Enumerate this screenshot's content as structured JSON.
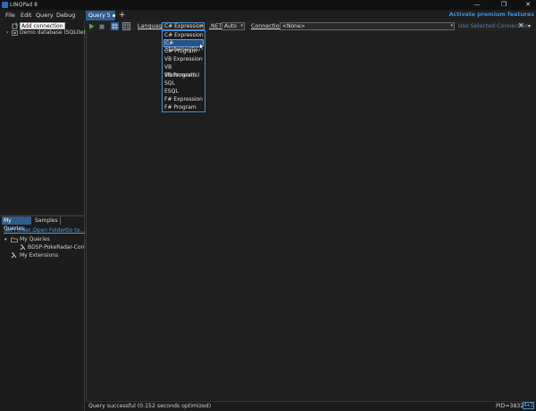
{
  "window": {
    "title": "LINQPad 8",
    "minimize": "—",
    "restore": "❐",
    "close": "✕"
  },
  "menu": [
    "File",
    "Edit",
    "Query",
    "Debug"
  ],
  "tabs": {
    "active": "Query 5",
    "add": "+"
  },
  "premium": "Activate premium features",
  "connections": {
    "add": "Add connection",
    "demo": "Demo database (SQLite)"
  },
  "toolbar": {
    "language_label": "Language",
    "language_value": "C# Expression",
    "net_label": ".NET",
    "net_value": "Auto",
    "connection_label": "Connection",
    "connection_value": "<None>",
    "use_selected": "Use Selected Connection"
  },
  "language_options": [
    "C# Expression",
    "C# Statement(s)",
    "C# Program",
    "VB Expression",
    "VB Statement(s)",
    "VB Program",
    "SQL",
    "ESQL",
    "F# Expression",
    "F# Program"
  ],
  "selected_option_index": 1,
  "left_tabs": {
    "my_queries": "My Queries",
    "samples": "Samples"
  },
  "left_links": {
    "set_folder": "Set Folder...",
    "open_folder": "Open Folder",
    "go_to": "Go to..."
  },
  "tree": {
    "my_queries": "My Queries",
    "query_item": "BDSP-PokeRadar-Contin...",
    "my_extensions": "My Extensions"
  },
  "status": {
    "text": "Query successful  (0.152 seconds optimized)",
    "pid": "PID=3832",
    "button": "4+1"
  },
  "colors": {
    "accent": "#2f5d8c",
    "link": "#4aa3ea",
    "run": "#4caf50",
    "premium": "#3a8fd6"
  }
}
